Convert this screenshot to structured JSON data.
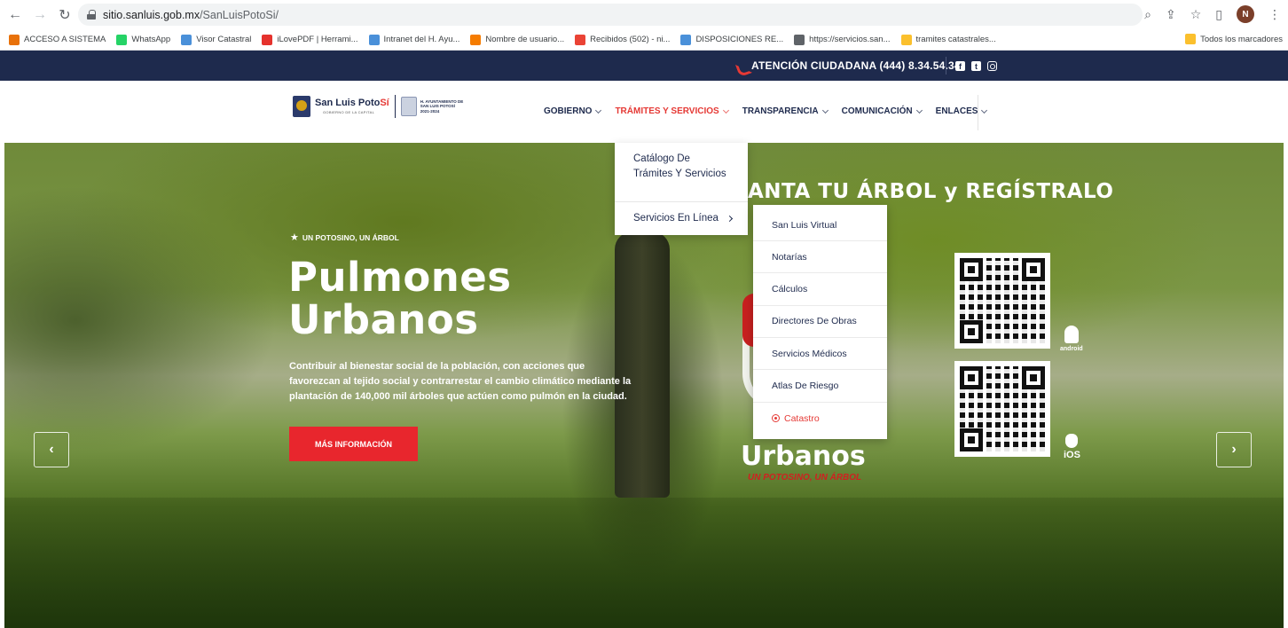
{
  "browser": {
    "url_host": "sitio.sanluis.gob.mx",
    "url_path": "/SanLuisPotoSi/",
    "profile_initial": "N",
    "bookmarks": [
      {
        "label": "ACCESO A SISTEMA",
        "color": "#e8710a"
      },
      {
        "label": "WhatsApp",
        "color": "#25d366"
      },
      {
        "label": "Visor Catastral",
        "color": "#4a90d9"
      },
      {
        "label": "iLovePDF | Herrami...",
        "color": "#e5322d"
      },
      {
        "label": "Intranet del H. Ayu...",
        "color": "#4a90d9"
      },
      {
        "label": "Nombre de usuario...",
        "color": "#f57c00"
      },
      {
        "label": "Recibidos (502) - ni...",
        "color": "#ea4335"
      },
      {
        "label": "DISPOSICIONES RE...",
        "color": "#4a90d9"
      },
      {
        "label": "https://servicios.san...",
        "color": "#5f6368"
      },
      {
        "label": "tramites catastrales...",
        "color": "#fbc02d"
      }
    ],
    "bookmarks_right": "Todos los marcadores"
  },
  "topbar": {
    "attention": "ATENCIÓN CIUDADANA (444) 8.34.54.34"
  },
  "header": {
    "logo_title_a": "San Luis Poto",
    "logo_title_b": "Sí",
    "logo_sub": "GOBIERNO DE LA CAPITAL",
    "ayto_text": "H. AYUNTAMIENTO DE SAN LUIS POTOSÍ 2021-2024",
    "menu": [
      {
        "label": "GOBIERNO",
        "active": false
      },
      {
        "label": "TRÁMITES Y SERVICIOS",
        "active": true
      },
      {
        "label": "TRANSPARENCIA",
        "active": false
      },
      {
        "label": "COMUNICACIÓN",
        "active": false
      },
      {
        "label": "ENLACES",
        "active": false
      }
    ]
  },
  "dropdown": {
    "items": [
      "Catálogo De Trámites Y Servicios",
      "Servicios En Línea"
    ]
  },
  "submenu": {
    "items": [
      "San Luis Virtual",
      "Notarías",
      "Cálculos",
      "Directores De Obras",
      "Servicios Médicos",
      "Atlas De Riesgo",
      "Catastro"
    ]
  },
  "hero": {
    "tag": "UN POTOSINO, UN ÁRBOL",
    "title_line1": "Pulmones",
    "title_line2": "Urbanos",
    "description": "Contribuir al bienestar social de la población, con acciones que favorezcan al tejido social y contrarrestar el cambio climático mediante la plantación de 140,000 mil árboles que actúen como pulmón en la ciudad.",
    "button": "MÁS INFORMACIÓN",
    "banner_title": "ANTA TU ÁRBOL y REGÍSTRALO",
    "banner_word": "Urbanos",
    "banner_slogan": "UN POTOSINO, UN ÁRBOL",
    "android_label": "android",
    "ios_label": "iOS"
  }
}
